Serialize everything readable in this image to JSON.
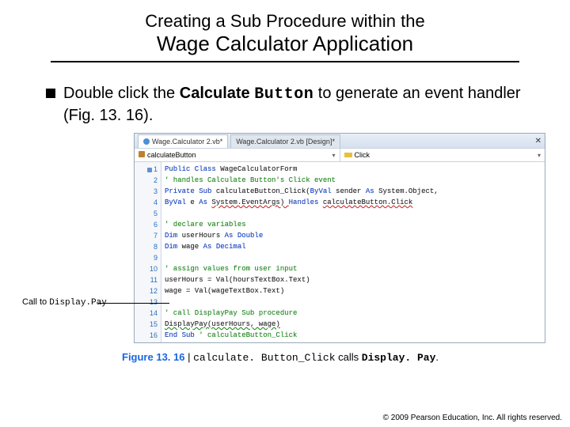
{
  "title": {
    "line1": "Creating a Sub Procedure within the",
    "line2_prefix": "Wage Calculator",
    "line2_suffix": " Application"
  },
  "bullet": {
    "pre": "Double click the ",
    "strong": "Calculate ",
    "mono": "Button",
    "post": " to generate an event handler (Fig. 13. 16)."
  },
  "callout": {
    "pre": "Call to ",
    "code": "Display.Pay"
  },
  "ide": {
    "tab1": "Wage.Calculator 2.vb*",
    "tab2": "Wage.Calculator 2.vb [Design]*",
    "close": "✕",
    "dropdown_left": "calculateButton",
    "dropdown_right": "Click"
  },
  "code": {
    "lines": [
      "1",
      "2",
      "3",
      "4",
      "5",
      "6",
      "7",
      "8",
      "9",
      "10",
      "11",
      "12",
      "13",
      "14",
      "15",
      "16"
    ],
    "l1": {
      "kw1": "Public Class ",
      "rest": "WageCalculatorForm"
    },
    "l2": "   ' handles Calculate Button's Click event",
    "l3": {
      "kw1": "   Private Sub ",
      "name": "calculateButton_Click(",
      "kw2": "ByVal ",
      "rest": "sender ",
      "kw3": "As ",
      "rest2": "System.Object,"
    },
    "l4": {
      "pre": "      ",
      "kw1": "ByVal ",
      "rest": "e ",
      "kw2": "As ",
      "rest2": "System.EventArgs) ",
      "kw3": "Handles ",
      "rest3": "calculateButton.Click"
    },
    "l6": "         ' declare variables",
    "l7": {
      "kw1": "         Dim ",
      "rest": "userHours ",
      "kw2": "As Double"
    },
    "l8": {
      "kw1": "         Dim ",
      "rest": "wage ",
      "kw2": "As Decimal"
    },
    "l10": "         ' assign values from user input",
    "l11": "         userHours = Val(hoursTextBox.Text)",
    "l12": "         wage = Val(wageTextBox.Text)",
    "l14": "         ' call DisplayPay Sub procedure",
    "l15": "         DisplayPay(userHours, wage)",
    "l16": {
      "kw1": "   End Sub ",
      "cm": "' calculateButton_Click"
    }
  },
  "caption": {
    "figno": "Figure 13. 16",
    "sep": " | ",
    "code": "calculate. Button_Click",
    "mid": " calls ",
    "bold": "Display. Pay",
    "end": "."
  },
  "footer": "© 2009 Pearson Education, Inc. All rights reserved."
}
